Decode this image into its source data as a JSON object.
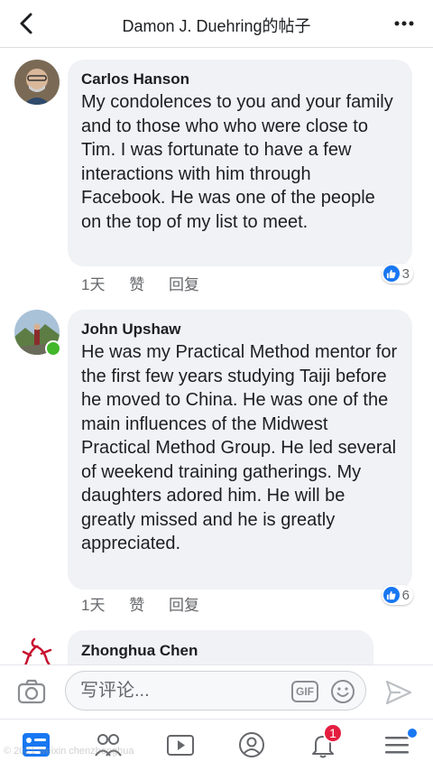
{
  "header": {
    "title": "Damon J. Duehring的帖子"
  },
  "comments": [
    {
      "author": "Carlos Hanson",
      "text": "My condolences to you and your family and to those who who were close to Tim. I was fortunate to have a few interactions with him through Facebook. He was one of the people on the top of my list to meet.",
      "time": "1天",
      "like_label": "赞",
      "reply_label": "回复",
      "reaction_count": "3"
    },
    {
      "author": "John Upshaw",
      "text": "He was my Practical Method mentor for  the first few years studying Taiji before he moved to China.  He was one of the main influences of the Midwest Practical Method Group.  He led several of weekend training gatherings.  My daughters adored him. He will be greatly missed and he is greatly appreciated.",
      "time": "1天",
      "like_label": "赞",
      "reply_label": "回复",
      "reaction_count": "6"
    },
    {
      "author": "Zhonghua Chen"
    }
  ],
  "composer": {
    "placeholder": "写评论...",
    "gif_label": "GIF"
  },
  "tabbar": {
    "notifications_badge": "1"
  },
  "watermark": "© 2021 weixin chenzhonghua"
}
